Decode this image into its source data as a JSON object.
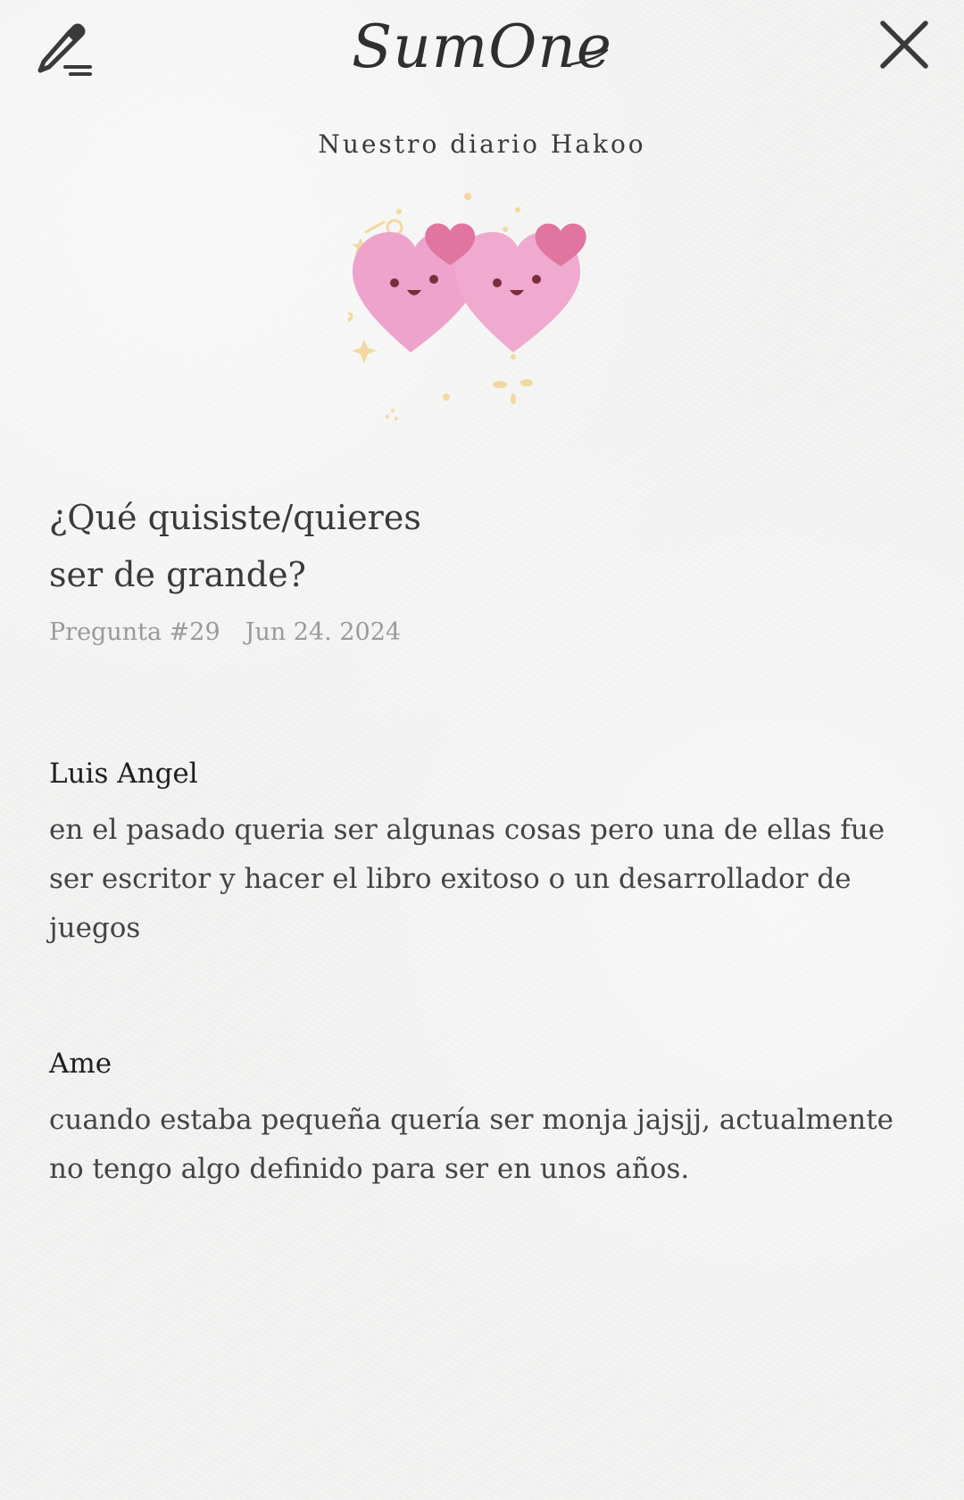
{
  "header": {
    "brand": "SumOne",
    "edit_icon": "pencil-edit-icon",
    "close_icon": "close-icon"
  },
  "diary": {
    "title": "Nuestro diario Hakoo"
  },
  "question": {
    "line1": "¿Qué quisiste/quieres",
    "line2": "ser de grande?",
    "number": "Pregunta #29",
    "date": "Jun 24. 2024"
  },
  "answers": [
    {
      "name": "Luis Angel",
      "text": "en el pasado queria ser algunas cosas pero una de ellas fue ser escritor y hacer el libro exitoso o un desarrollador de juegos"
    },
    {
      "name": "Ame",
      "text": "cuando estaba pequeña quería ser monja jajsjj, actualmente no tengo algo definido para ser en unos años."
    }
  ],
  "colors": {
    "background": "#f3f3f2",
    "heart": "#eea3cc",
    "heart_small": "#e0759f",
    "sparkle": "#f3d9a0",
    "text_dark": "#333333",
    "text_muted": "#9a9a9a"
  }
}
